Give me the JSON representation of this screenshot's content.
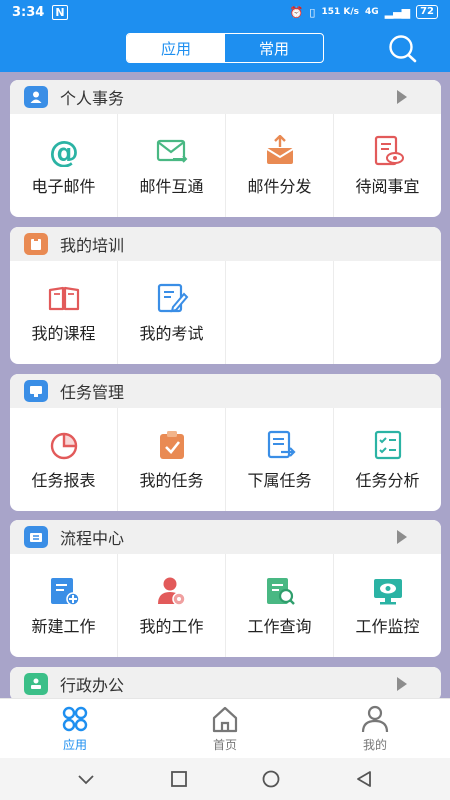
{
  "status": {
    "time": "3:34",
    "net_speed": "151 K/s",
    "network": "4G",
    "battery": "72"
  },
  "header": {
    "segments": [
      "应用",
      "常用"
    ],
    "active_segment": 0
  },
  "colors": {
    "primary": "#1e8ff0",
    "background": "#a8a4c9"
  },
  "sections": [
    {
      "title": "个人事务",
      "icon": "person-icon",
      "badge_color": "#3a8ee6",
      "has_arrow": true,
      "items": [
        {
          "label": "电子邮件",
          "icon": "at-icon"
        },
        {
          "label": "邮件互通",
          "icon": "mail-exchange-icon"
        },
        {
          "label": "邮件分发",
          "icon": "mail-send-icon"
        },
        {
          "label": "待阅事宜",
          "icon": "document-view-icon"
        }
      ]
    },
    {
      "title": "我的培训",
      "icon": "clipboard-icon",
      "badge_color": "#e98a53",
      "has_arrow": false,
      "items": [
        {
          "label": "我的课程",
          "icon": "book-icon"
        },
        {
          "label": "我的考试",
          "icon": "exam-edit-icon"
        }
      ]
    },
    {
      "title": "任务管理",
      "icon": "monitor-icon",
      "badge_color": "#3a8ee6",
      "has_arrow": false,
      "items": [
        {
          "label": "任务报表",
          "icon": "pie-chart-icon"
        },
        {
          "label": "我的任务",
          "icon": "task-check-icon"
        },
        {
          "label": "下属任务",
          "icon": "subtask-icon"
        },
        {
          "label": "任务分析",
          "icon": "checklist-icon"
        }
      ]
    },
    {
      "title": "流程中心",
      "icon": "workflow-icon",
      "badge_color": "#3a8ee6",
      "has_arrow": true,
      "items": [
        {
          "label": "新建工作",
          "icon": "new-work-icon"
        },
        {
          "label": "我的工作",
          "icon": "user-work-icon"
        },
        {
          "label": "工作查询",
          "icon": "search-document-icon"
        },
        {
          "label": "工作监控",
          "icon": "monitor-eye-icon"
        }
      ]
    },
    {
      "title": "行政办公",
      "icon": "admin-icon",
      "badge_color": "#3bbf88",
      "has_arrow": true,
      "items": []
    }
  ],
  "tabbar": [
    {
      "label": "应用",
      "icon": "apps-icon",
      "active": true
    },
    {
      "label": "首页",
      "icon": "home-icon",
      "active": false
    },
    {
      "label": "我的",
      "icon": "profile-icon",
      "active": false
    }
  ]
}
